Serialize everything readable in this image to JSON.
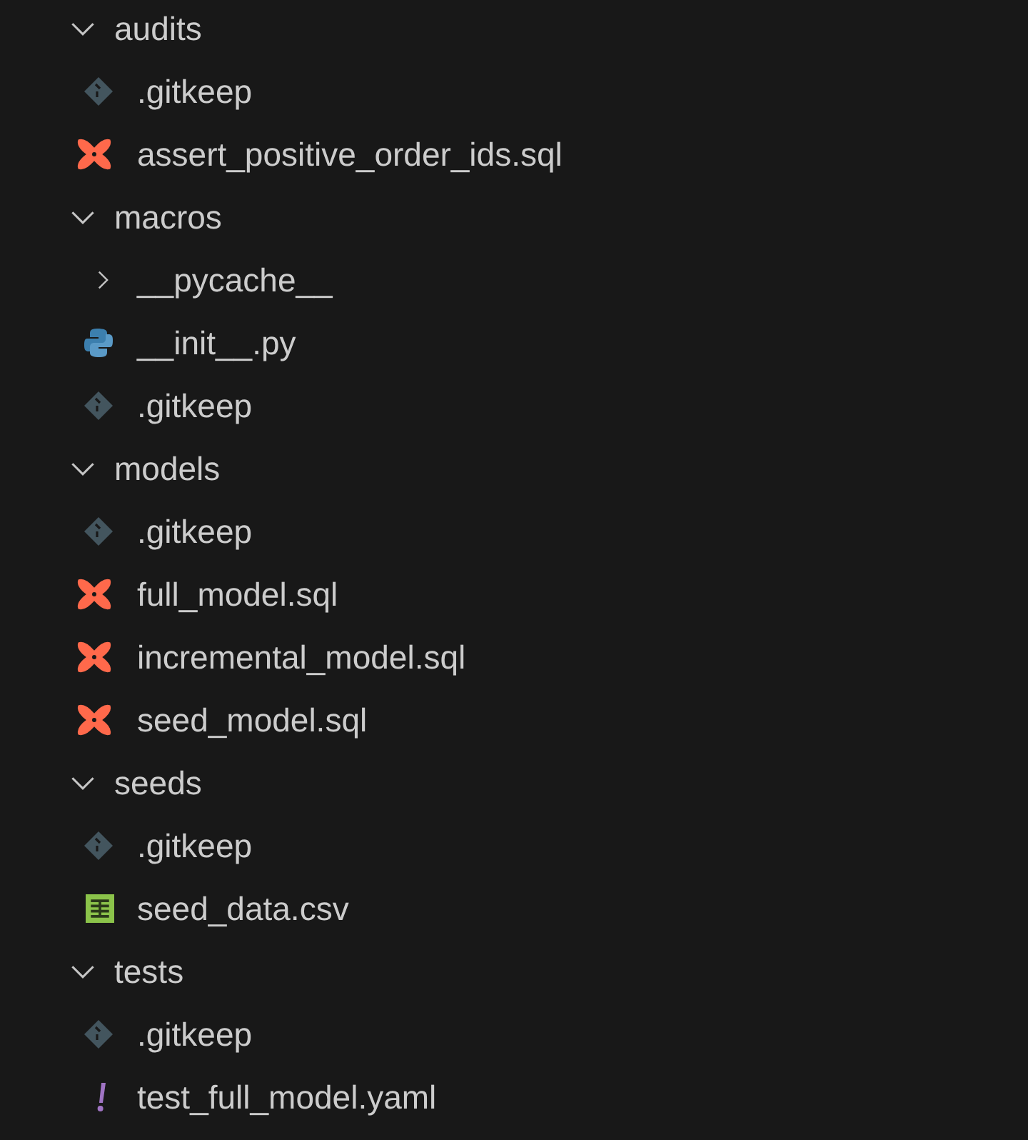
{
  "tree": [
    {
      "name": "audits",
      "kind": "folder",
      "expanded": true,
      "children": [
        {
          "name": ".gitkeep",
          "kind": "git"
        },
        {
          "name": "assert_positive_order_ids.sql",
          "kind": "dbt"
        }
      ]
    },
    {
      "name": "macros",
      "kind": "folder",
      "expanded": true,
      "children": [
        {
          "name": "__pycache__",
          "kind": "folder",
          "expanded": false
        },
        {
          "name": "__init__.py",
          "kind": "python"
        },
        {
          "name": ".gitkeep",
          "kind": "git"
        }
      ]
    },
    {
      "name": "models",
      "kind": "folder",
      "expanded": true,
      "children": [
        {
          "name": ".gitkeep",
          "kind": "git"
        },
        {
          "name": "full_model.sql",
          "kind": "dbt"
        },
        {
          "name": "incremental_model.sql",
          "kind": "dbt"
        },
        {
          "name": "seed_model.sql",
          "kind": "dbt"
        }
      ]
    },
    {
      "name": "seeds",
      "kind": "folder",
      "expanded": true,
      "children": [
        {
          "name": ".gitkeep",
          "kind": "git"
        },
        {
          "name": "seed_data.csv",
          "kind": "csv"
        }
      ]
    },
    {
      "name": "tests",
      "kind": "folder",
      "expanded": true,
      "children": [
        {
          "name": ".gitkeep",
          "kind": "git"
        },
        {
          "name": "test_full_model.yaml",
          "kind": "yaml"
        }
      ]
    }
  ]
}
